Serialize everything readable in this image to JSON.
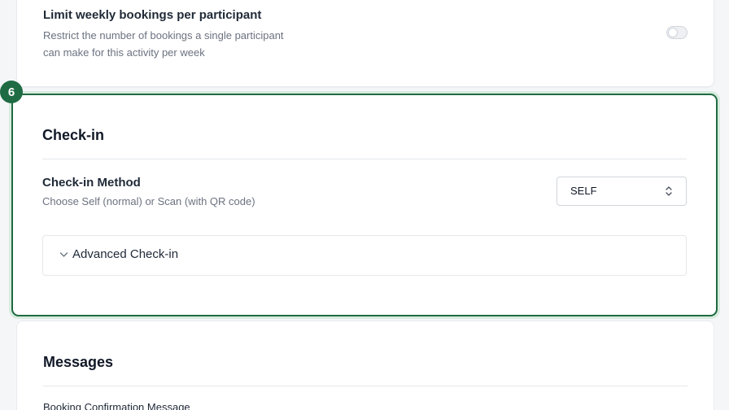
{
  "limit_weekly": {
    "title": "Limit weekly bookings per participant",
    "description": "Restrict the number of bookings a single participant can make for this activity per week",
    "enabled": false
  },
  "step_badge": "6",
  "checkin": {
    "title": "Check-in",
    "method": {
      "title": "Check-in Method",
      "description": "Choose Self (normal) or Scan (with QR code)",
      "selected": "SELF"
    },
    "advanced_label": "Advanced Check-in"
  },
  "messages": {
    "title": "Messages",
    "first_item_label": "Booking Confirmation Message"
  },
  "colors": {
    "accent": "#1f6b43",
    "highlight_ring": "#d7ebdf",
    "muted_text": "#6b7280"
  }
}
